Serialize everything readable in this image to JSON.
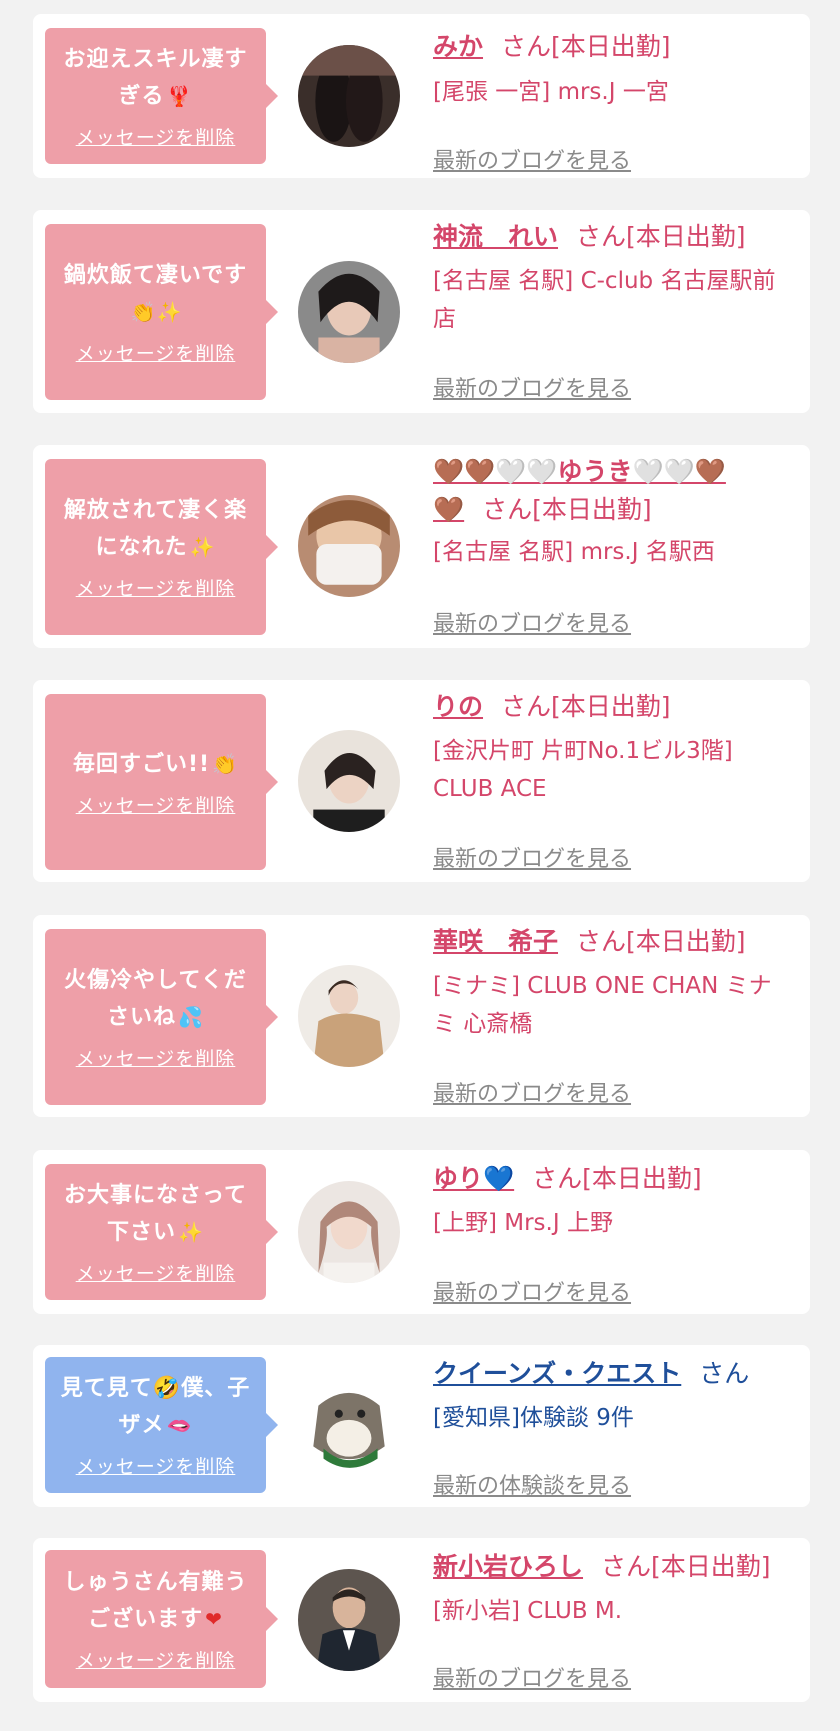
{
  "cards": [
    {
      "theme": "pink",
      "message": "お迎えスキル凄すぎる",
      "message_emoji": "🦞",
      "delete_label": "メッセージを削除",
      "name": "みか",
      "suffix": "さん[本日出勤]",
      "shop": "[尾張 一宮] mrs.J 一宮",
      "blog_link": "最新のブログを見る"
    },
    {
      "theme": "pink",
      "message": "鍋炊飯て凄いです",
      "message_emoji": "👏✨",
      "delete_label": "メッセージを削除",
      "name": "神流　れい",
      "suffix": "さん[本日出勤]",
      "shop": "[名古屋 名駅] C-club 名古屋駅前店",
      "blog_link": "最新のブログを見る"
    },
    {
      "theme": "pink",
      "message": "解放されて凄く楽になれた",
      "message_emoji": "✨",
      "delete_label": "メッセージを削除",
      "name": "🤎🤎🤍🤍ゆうき🤍🤍🤎",
      "name_tail": "🤎",
      "suffix": "さん[本日出勤]",
      "shop": "[名古屋 名駅] mrs.J 名駅西",
      "blog_link": "最新のブログを見る"
    },
    {
      "theme": "pink",
      "message": "毎回すごい!!",
      "message_emoji": "👏",
      "delete_label": "メッセージを削除",
      "name": "りの",
      "suffix": "さん[本日出勤]",
      "shop": "[金沢片町 片町No.1ビル3階] CLUB ACE",
      "blog_link": "最新のブログを見る"
    },
    {
      "theme": "pink",
      "message": "火傷冷やしてくださいね",
      "message_emoji": "💦",
      "delete_label": "メッセージを削除",
      "name": "華咲　希子",
      "suffix": "さん[本日出勤]",
      "shop": "[ミナミ] CLUB ONE CHAN ミナミ 心斎橋",
      "blog_link": "最新のブログを見る"
    },
    {
      "theme": "pink",
      "message": "お大事になさって下さい",
      "message_emoji": "✨",
      "delete_label": "メッセージを削除",
      "name": "ゆり💙",
      "suffix": "さん[本日出勤]",
      "shop": "[上野] Mrs.J 上野",
      "blog_link": "最新のブログを見る"
    },
    {
      "theme": "blue",
      "message": "見て見て🤣僕、子ザメ",
      "message_emoji": "🫦",
      "delete_label": "メッセージを削除",
      "name": "クイーンズ・クエスト",
      "suffix": "さん",
      "shop": "[愛知県]体験談 9件",
      "blog_link": "最新の体験談を見る"
    },
    {
      "theme": "pink",
      "message": "しゅうさん有難うございます",
      "message_emoji": "❤",
      "delete_label": "メッセージを削除",
      "name": "新小岩ひろし",
      "suffix": "さん[本日出勤]",
      "shop": "[新小岩] CLUB M.",
      "blog_link": "最新のブログを見る"
    }
  ]
}
